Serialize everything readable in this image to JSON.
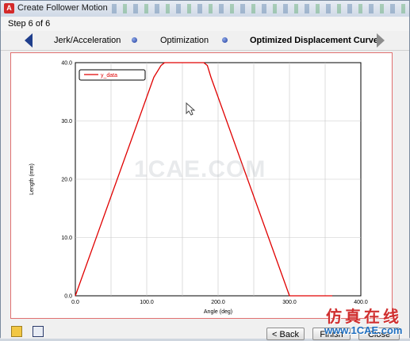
{
  "window": {
    "title": "Create Follower Motion",
    "app_icon": "A"
  },
  "step": {
    "text": "Step 6 of 6"
  },
  "nav": {
    "steps": [
      {
        "label": "Jerk/Acceleration",
        "active": false
      },
      {
        "label": "Optimization",
        "active": false
      },
      {
        "label": "Optimized Displacement Curve",
        "active": true
      }
    ],
    "prev_icon": "left-arrow-icon",
    "next_icon": "right-arrow-icon"
  },
  "chart_data": {
    "type": "line",
    "xlabel": "Angle (deg)",
    "ylabel": "Length (mm)",
    "xlim": [
      0,
      400
    ],
    "ylim": [
      0,
      40
    ],
    "x_ticks": [
      "0.0",
      "100.0",
      "200.0",
      "300.0",
      "400.0"
    ],
    "y_ticks": [
      "0.0",
      "10.0",
      "20.0",
      "30.0",
      "40.0"
    ],
    "grid": true,
    "legend": "top-left",
    "series": [
      {
        "name": "y_data",
        "color": "#e00000",
        "x": [
          0,
          110,
          120,
          125,
          180,
          185,
          190,
          300,
          360
        ],
        "y": [
          0,
          37.5,
          39.5,
          40,
          40,
          39.5,
          37.5,
          0,
          0
        ]
      }
    ]
  },
  "buttons": {
    "back_label": "< Back",
    "finish_label": "Finish",
    "close_label": "Close"
  },
  "toolbar_icons": [
    "folder-icon",
    "save-icon"
  ],
  "watermark": {
    "center": "1CAE.COM",
    "chinese": "仿真在线",
    "url": "www.1CAE.com"
  }
}
